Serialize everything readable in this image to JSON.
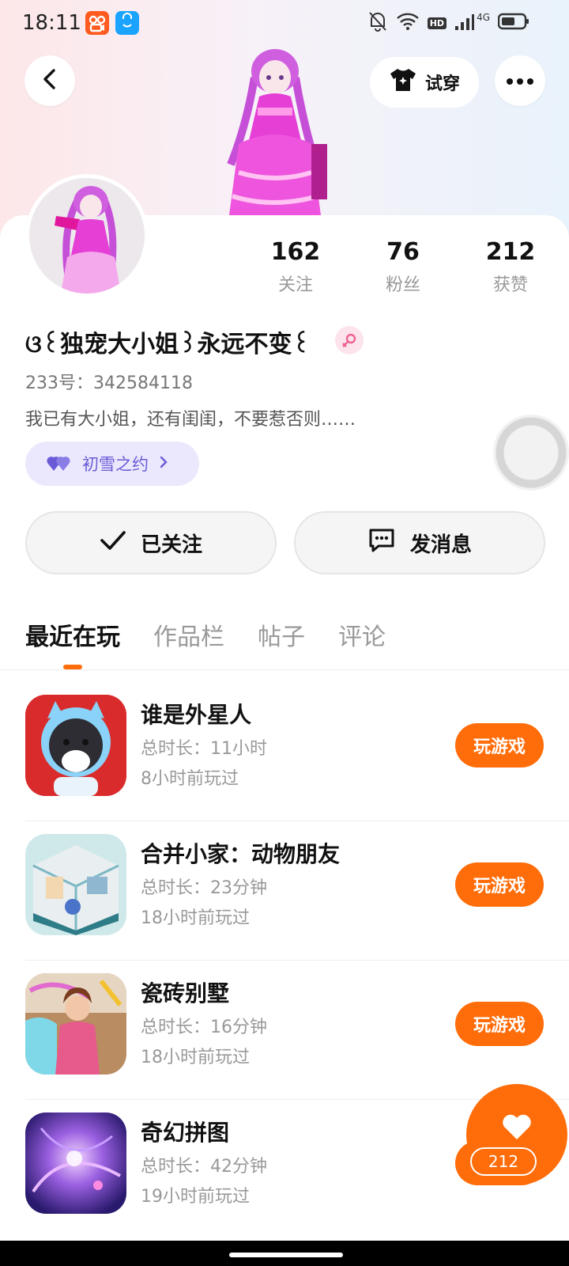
{
  "status_bar": {
    "time": "18:11",
    "network": "4G",
    "hd": "HD"
  },
  "header": {
    "back_icon": "chevron-left-icon",
    "tryon_label": "试穿",
    "more_icon": "more-dots-icon"
  },
  "profile": {
    "nickname": "ଓ꒰独宠大小姐꒱永远不变꒰",
    "gender": "female",
    "id_text": "233号：342584118",
    "bio": "我已有大小姐，还有闺闺，不要惹否则……",
    "tag_label": "初雪之约",
    "stats": [
      {
        "value": "162",
        "label": "关注"
      },
      {
        "value": "76",
        "label": "粉丝"
      },
      {
        "value": "212",
        "label": "获赞"
      }
    ]
  },
  "actions": {
    "follow_label": "已关注",
    "message_label": "发消息"
  },
  "tabs": [
    "最近在玩",
    "作品栏",
    "帖子",
    "评论"
  ],
  "games": [
    {
      "title": "谁是外星人",
      "duration": "总时长：11小时",
      "last_played": "8小时前玩过",
      "button": "玩游戏"
    },
    {
      "title": "合并小家：动物朋友",
      "duration": "总时长：23分钟",
      "last_played": "18小时前玩过",
      "button": "玩游戏"
    },
    {
      "title": "瓷砖别墅",
      "duration": "总时长：16分钟",
      "last_played": "18小时前玩过",
      "button": "玩游戏"
    },
    {
      "title": "奇幻拼图",
      "duration": "总时长：42分钟",
      "last_played": "19小时前玩过",
      "button": "玩游戏"
    }
  ],
  "like_fab": {
    "count": "212"
  },
  "colors": {
    "accent": "#ff6d0a",
    "tag_bg": "#ebe8fd",
    "tag_text": "#6a5cd6"
  }
}
